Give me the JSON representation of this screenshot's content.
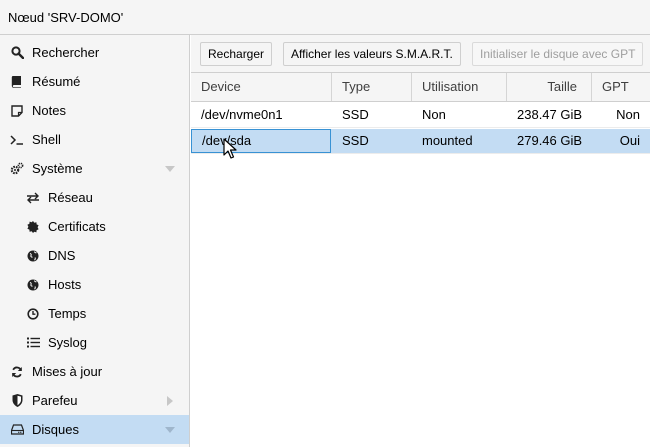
{
  "window": {
    "title": "Nœud 'SRV-DOMO'"
  },
  "sidebar": {
    "items": [
      {
        "label": "Rechercher",
        "icon": "search-icon"
      },
      {
        "label": "Résumé",
        "icon": "book-icon"
      },
      {
        "label": "Notes",
        "icon": "note-icon"
      },
      {
        "label": "Shell",
        "icon": "terminal-icon"
      },
      {
        "label": "Système",
        "icon": "gears-icon"
      },
      {
        "label": "Réseau",
        "icon": "exchange-icon"
      },
      {
        "label": "Certificats",
        "icon": "certificate-icon"
      },
      {
        "label": "DNS",
        "icon": "globe-icon"
      },
      {
        "label": "Hosts",
        "icon": "globe-icon"
      },
      {
        "label": "Temps",
        "icon": "clock-icon"
      },
      {
        "label": "Syslog",
        "icon": "list-icon"
      },
      {
        "label": "Mises à jour",
        "icon": "refresh-icon"
      },
      {
        "label": "Parefeu",
        "icon": "shield-icon"
      },
      {
        "label": "Disques",
        "icon": "hdd-icon"
      }
    ]
  },
  "toolbar": {
    "reload_label": "Recharger",
    "smart_label": "Afficher les valeurs S.M.A.R.T.",
    "init_gpt_label": "Initialiser le disque avec GPT"
  },
  "table": {
    "columns": [
      "Device",
      "Type",
      "Utilisation",
      "Taille",
      "GPT"
    ],
    "rows": [
      {
        "device": "/dev/nvme0n1",
        "type": "SSD",
        "usage": "Non",
        "size": "238.47 GiB",
        "gpt": "Non"
      },
      {
        "device": "/dev/sda",
        "type": "SSD",
        "usage": "mounted",
        "size": "279.46 GiB",
        "gpt": "Oui"
      }
    ]
  },
  "colors": {
    "selection": "#c3dcf3",
    "panel_bg": "#f5f5f5",
    "focus_border": "#3892d4"
  }
}
